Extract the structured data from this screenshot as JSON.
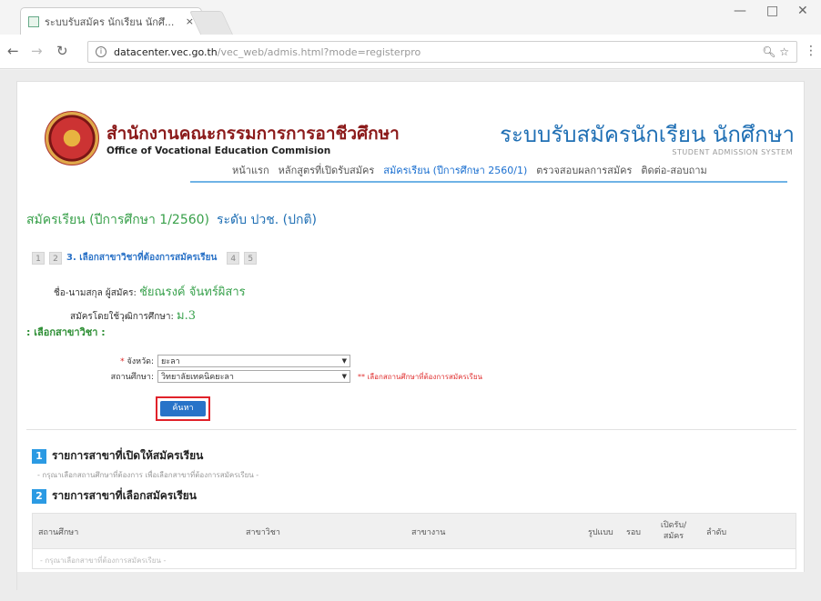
{
  "browser": {
    "tab_title": "ระบบรับสมัคร นักเรียน นักศึ...",
    "tab_close": "×",
    "url_host": "datacenter.vec.go.th",
    "url_path": "/vec_web/admis.html?mode=registerpro",
    "minimize": "—",
    "maximize": "□",
    "close": "✕"
  },
  "header": {
    "org_th": "สำนักงานคณะกรรมการการอาชีวศึกษา",
    "org_en": "Office of Vocational Education Commision",
    "system_th": "ระบบรับสมัครนักเรียน นักศึกษา",
    "system_en": "STUDENT ADMISSION SYSTEM"
  },
  "nav": [
    {
      "label": "หน้าแรก",
      "active": false
    },
    {
      "label": "หลักสูตรที่เปิดรับสมัคร",
      "active": false
    },
    {
      "label": "สมัครเรียน (ปีการศึกษา 2560/1)",
      "active": true
    },
    {
      "label": "ตรวจสอบผลการสมัคร",
      "active": false
    },
    {
      "label": "ติดต่อ-สอบถาม",
      "active": false
    }
  ],
  "page": {
    "heading": "สมัครเรียน (ปีการศึกษา 1/2560)",
    "level": "ระดับ ปวช. (ปกติ)"
  },
  "steps": {
    "s1": "1",
    "s2": "2",
    "current_label": "3. เลือกสาขาวิชาที่ต้องการสมัครเรียน",
    "s4": "4",
    "s5": "5"
  },
  "applicant": {
    "name_label": "ชื่อ-นามสกุล ผู้สมัคร:",
    "name_value": "ชัยณรงค์ จันทร์ผิสาร",
    "edu_label": "สมัครโดยใช้วุฒิการศึกษา:",
    "edu_value": "ม.3"
  },
  "form": {
    "section_title": ": เลือกสาขาวิชา :",
    "province_label": "จังหวัด:",
    "province_value": "ยะลา",
    "school_label": "สถานศึกษา:",
    "school_value": "วิทยาลัยเทคนิคยะลา",
    "school_note": "** เลือกสถานศึกษาที่ต้องการสมัครเรียน",
    "search_button": "ค้นหา"
  },
  "section1": {
    "num": "1",
    "title": "รายการสาขาที่เปิดให้สมัครเรียน",
    "subtitle": "- กรุณาเลือกสถานศึกษาที่ต้องการ เพื่อเลือกสาขาที่ต้องการสมัครเรียน -"
  },
  "section2": {
    "num": "2",
    "title": "รายการสาขาที่เลือกสมัครเรียน",
    "columns": [
      "สถานศึกษา",
      "สาขาวิชา",
      "สาขางาน",
      "รูปแบบ",
      "รอบ",
      "เปิดรับ/สมัคร",
      "ลำดับ"
    ],
    "empty_text": "- กรุณาเลือกสาขาที่ต้องการสมัครเรียน -"
  }
}
